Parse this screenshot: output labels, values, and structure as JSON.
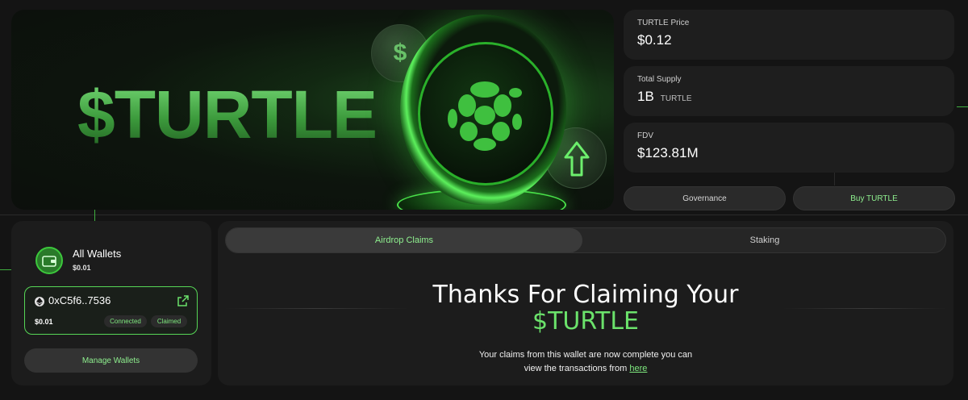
{
  "hero": {
    "title": "$TURTLE",
    "small_coin_symbol": "$"
  },
  "stats": [
    {
      "label": "TURTLE Price",
      "value": "$0.12",
      "unit": ""
    },
    {
      "label": "Total Supply",
      "value": "1B",
      "unit": "TURTLE"
    },
    {
      "label": "FDV",
      "value": "$123.81M",
      "unit": ""
    }
  ],
  "buttons": {
    "governance": "Governance",
    "buy": "Buy TURTLE"
  },
  "wallets": {
    "title": "All Wallets",
    "total": "$0.01",
    "card": {
      "address": "0xC5f6..7536",
      "balance": "$0.01",
      "badges": [
        "Connected",
        "Claimed"
      ]
    },
    "manage_label": "Manage Wallets"
  },
  "tabs": [
    {
      "label": "Airdrop Claims",
      "active": true
    },
    {
      "label": "Staking",
      "active": false
    }
  ],
  "claim": {
    "heading": "Thanks For Claiming Your",
    "token": "$TURTLE",
    "desc_line1": "Your claims from this wallet are now complete you can",
    "desc_line2": "view the transactions from",
    "link": "here"
  },
  "colors": {
    "accent": "#6be26b",
    "background": "#141414",
    "card": "#1e1e1e"
  }
}
